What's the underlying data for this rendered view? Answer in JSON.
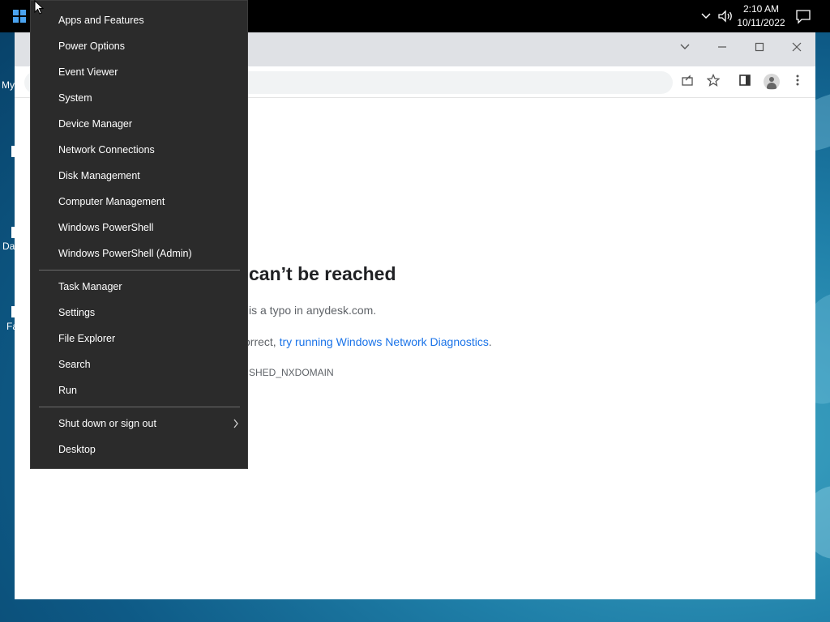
{
  "taskbar": {
    "clock_time": "2:10 AM",
    "clock_date": "10/11/2022"
  },
  "desktop": {
    "labels": [
      "My",
      "Da",
      "Fa"
    ]
  },
  "browser": {
    "window_controls": [
      "tab-search-icon",
      "minimize-icon",
      "maximize-icon",
      "close-icon"
    ],
    "toolbar_icons": [
      "share-icon",
      "bookmark-star-icon",
      "side-panel-icon",
      "profile-icon",
      "more-menu-icon"
    ],
    "error": {
      "title": "can’t be reached",
      "line1": "is a typo in anydesk.com.",
      "line2_prefix": "orrect, ",
      "line2_link": "try running Windows Network Diagnostics",
      "line2_suffix": ".",
      "code": "SHED_NXDOMAIN"
    }
  },
  "context_menu": {
    "group1": [
      "Apps and Features",
      "Power Options",
      "Event Viewer",
      "System",
      "Device Manager",
      "Network Connections",
      "Disk Management",
      "Computer Management",
      "Windows PowerShell",
      "Windows PowerShell (Admin)"
    ],
    "group2": [
      "Task Manager",
      "Settings",
      "File Explorer",
      "Search",
      "Run"
    ],
    "group3": [
      "Shut down or sign out",
      "Desktop"
    ]
  },
  "colors": {
    "menu_bg": "#2b2b2b",
    "menu_text": "#ffffff",
    "link": "#1a73e8",
    "windows_accent": "#4aa3f0"
  }
}
